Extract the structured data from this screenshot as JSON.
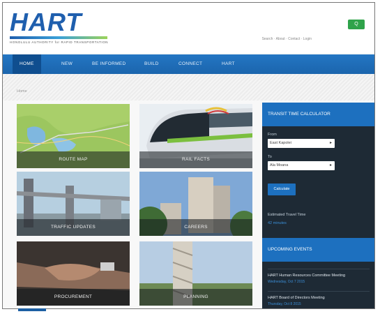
{
  "header": {
    "logo_text": "HART",
    "logo_tagline": "HONOLULU AUTHORITY for RAPID TRANSPORTATION",
    "search_label": "Q",
    "util_links": "Search · About · Contact · Login"
  },
  "nav": {
    "items": [
      {
        "label": "HOME"
      },
      {
        "label": "NEW"
      },
      {
        "label": "BE INFORMED"
      },
      {
        "label": "BUILD"
      },
      {
        "label": "CONNECT"
      },
      {
        "label": "HART"
      }
    ]
  },
  "breadcrumb": "Home",
  "tiles": [
    {
      "label": "ROUTE MAP"
    },
    {
      "label": "RAIL FACTS"
    },
    {
      "label": "TRAFFIC UPDATES"
    },
    {
      "label": "CAREERS"
    },
    {
      "label": "PROCUREMENT"
    },
    {
      "label": "PLANNING"
    }
  ],
  "sidebar": {
    "calculator": {
      "title": "TRANSIT TIME CALCULATOR",
      "from_label": "From",
      "from_value": "East Kapolei",
      "to_label": "To",
      "to_value": "Ala Moana",
      "button_label": "Calculate",
      "estimated_label": "Estimated Travel Time",
      "estimated_value": "42 minutes"
    },
    "events": {
      "title": "UPCOMING EVENTS",
      "items": [
        {
          "title": "HART Human Resources Committee Meeting",
          "date": "Wednesday, Oct 7 2015"
        },
        {
          "title": "HART Board of Directors Meeting",
          "date": "Thursday, Oct 8 2015"
        }
      ]
    }
  },
  "colors": {
    "brand_blue": "#1d70bf",
    "nav_blue": "#2476c3",
    "green": "#2fa34a",
    "sidebar_dark": "#1e2a35"
  }
}
